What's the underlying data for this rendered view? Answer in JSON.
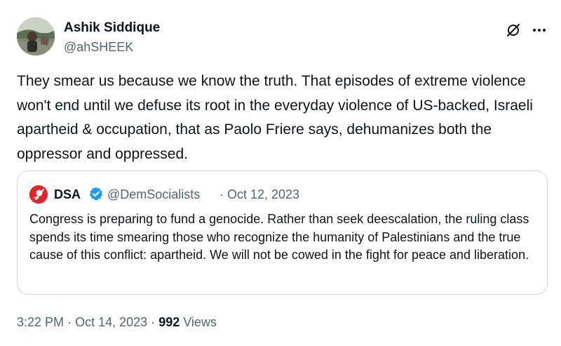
{
  "author": {
    "name": "Ashik Siddique",
    "handle": "@ahSHEEK",
    "avatar_icon": "profile-photo"
  },
  "actions": {
    "grok_icon": "grok-slash-circle-icon",
    "more_icon": "more-dots-icon"
  },
  "tweet": {
    "text": "They smear us because we know the truth. That episodes of extreme violence won't end until we defuse its root in the everyday violence of US-backed, Israeli apartheid & occupation, that as Paolo Friere says, dehumanizes both the oppressor and oppressed."
  },
  "quoted": {
    "name": "DSA",
    "verified_icon": "verified-badge-icon",
    "handle": "@DemSocialists",
    "separator": "·",
    "date": "Oct 12, 2023",
    "text": "Congress is preparing to fund a genocide. Rather than seek deescalation, the ruling class spends its time smearing those who recognize the humanity of Palestinians and the true cause of this conflict: apartheid. We will not be cowed in the fight for peace and liberation.",
    "avatar_color": "#e2242a"
  },
  "meta": {
    "time": "3:22 PM",
    "sep1": "·",
    "date": "Oct 14, 2023",
    "sep2": "·",
    "views_count": "992",
    "views_label": "Views"
  },
  "colors": {
    "text": "#0f1419",
    "secondary": "#536471",
    "border": "#cfd9de",
    "verified": "#1d9bf0"
  }
}
